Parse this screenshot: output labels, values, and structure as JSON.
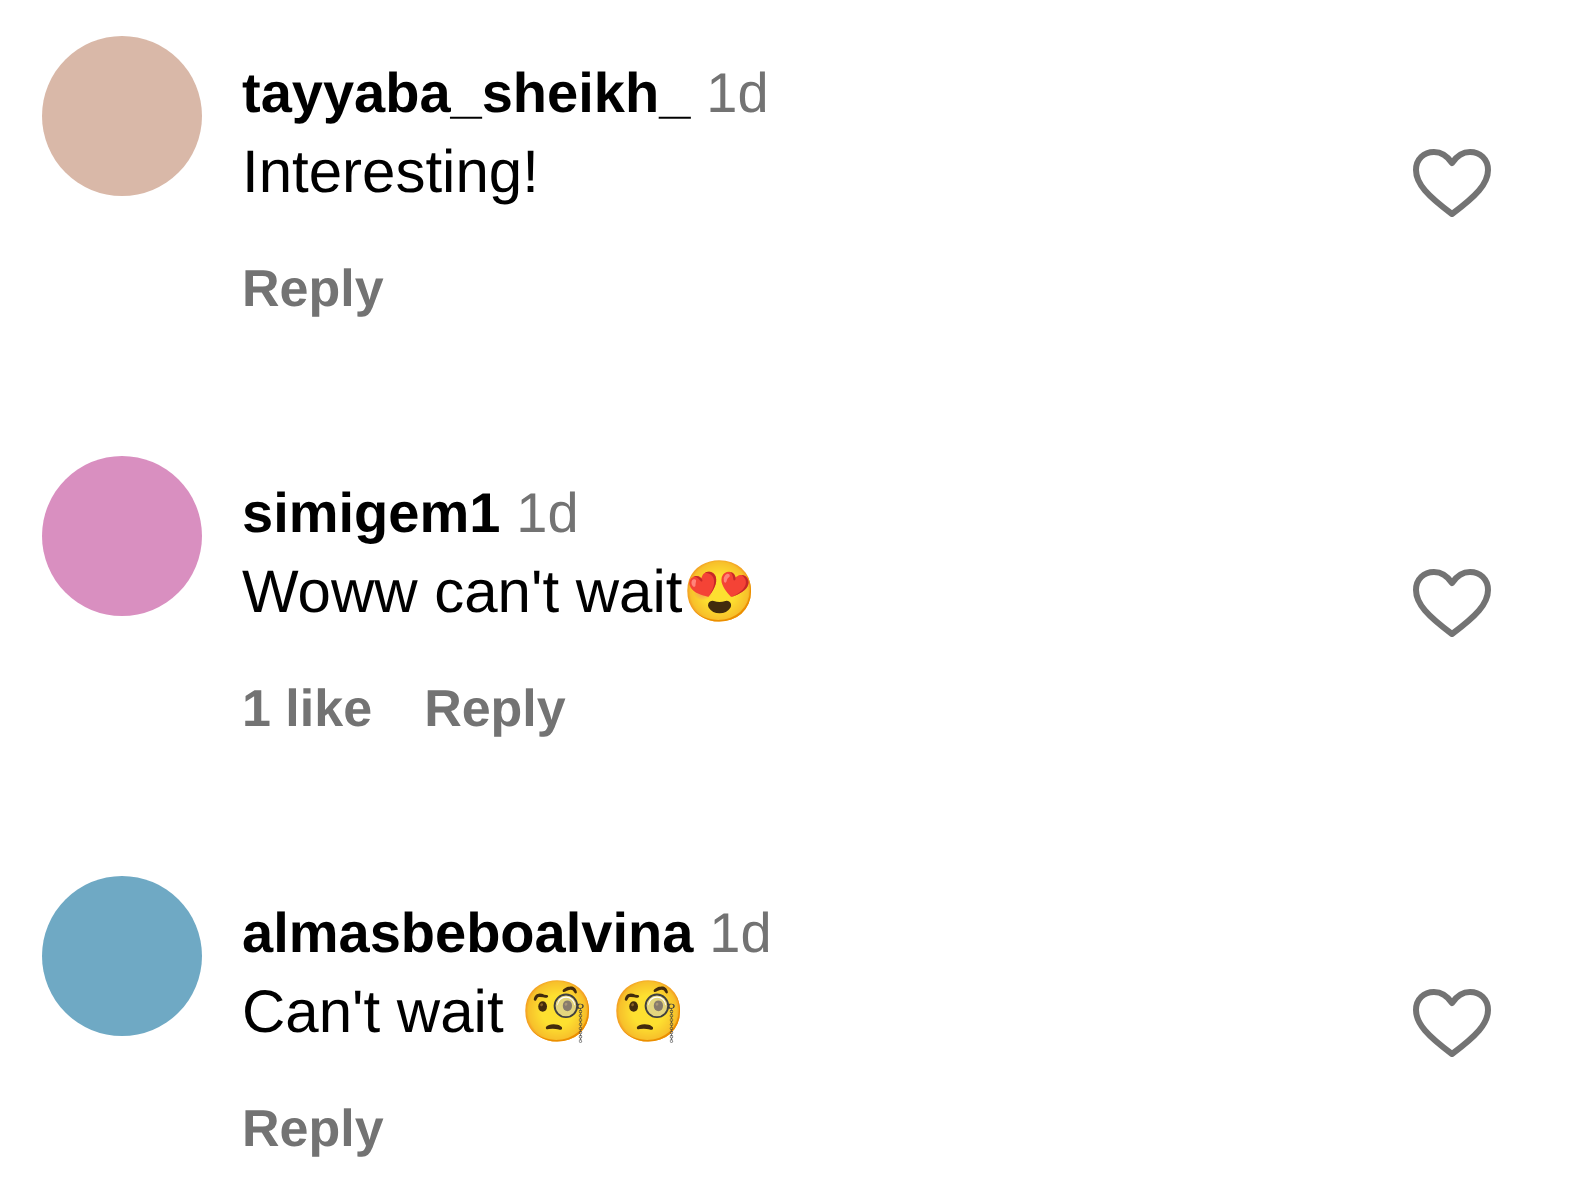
{
  "comments": [
    {
      "username": "tayyaba_sheikh_",
      "time": "1d",
      "text": "Interesting!",
      "color": "#d9b8a8",
      "reply": "Reply",
      "liked": false
    },
    {
      "username": "simigem1",
      "time": "1d",
      "text": "Woww can't wait😍",
      "color": "#d98fc0",
      "likes": "1 like",
      "reply": "Reply",
      "liked": false
    },
    {
      "username": "almasbeboalvina",
      "time": "1d",
      "text": "Can't wait 🧐 🧐",
      "color": "#6fa9c4",
      "reply": "Reply",
      "liked": false
    }
  ]
}
